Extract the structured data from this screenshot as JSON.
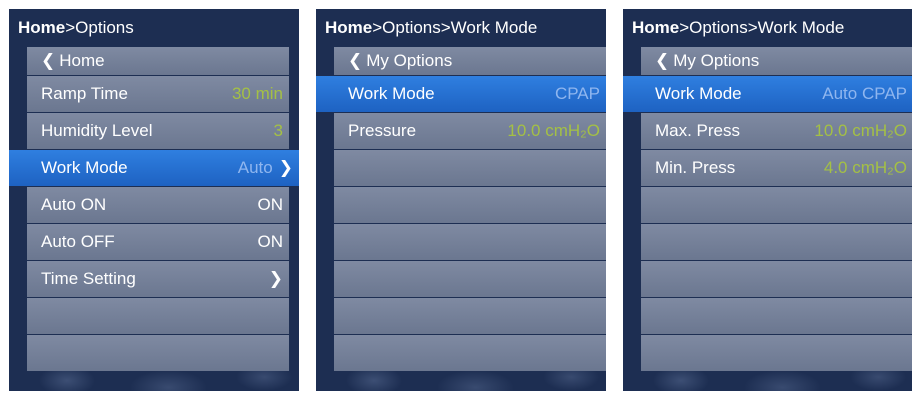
{
  "screen1": {
    "crumb_bold": "Home",
    "crumb_rest": ">Options",
    "back_label": "Home",
    "rows": [
      {
        "label": "Ramp Time",
        "value": "30 min"
      },
      {
        "label": "Humidity Level",
        "value": "3"
      },
      {
        "label": "Work Mode",
        "value": "Auto"
      },
      {
        "label": "Auto  ON",
        "value": "ON"
      },
      {
        "label": "Auto  OFF",
        "value": "ON"
      },
      {
        "label": "Time Setting",
        "value": ""
      }
    ]
  },
  "screen2": {
    "crumb_bold": "Home",
    "crumb_rest": ">Options>Work Mode",
    "back_label": "My Options",
    "rows": [
      {
        "label": "Work Mode",
        "value": "CPAP"
      },
      {
        "label": "Pressure",
        "value": "10.0 cmH₂O"
      }
    ]
  },
  "screen3": {
    "crumb_bold": "Home",
    "crumb_rest": ">Options>Work Mode",
    "back_label": "My Options",
    "rows": [
      {
        "label": "Work Mode",
        "value": "Auto CPAP"
      },
      {
        "label": "Max. Press",
        "value": "10.0 cmH₂O"
      },
      {
        "label": "Min. Press",
        "value": "4.0 cmH₂O"
      }
    ]
  },
  "colors": {
    "selected": "#2f7fe0",
    "row": "#7f8aa2",
    "value_green": "#a4c045",
    "background": "#1d2e52"
  },
  "icons": {
    "back": "chevron-left-icon",
    "forward": "chevron-right-icon"
  }
}
